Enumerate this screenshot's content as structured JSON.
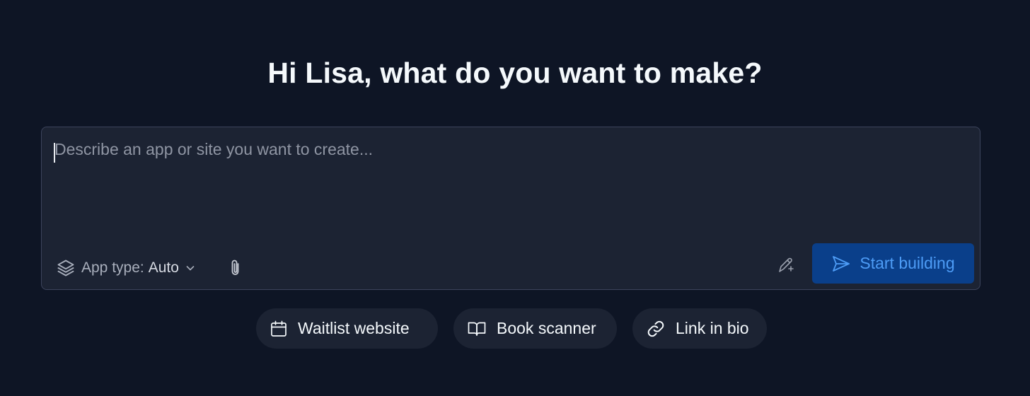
{
  "greeting": "Hi Lisa, what do you want to make?",
  "prompt": {
    "placeholder": "Describe an app or site you want to create...",
    "value": ""
  },
  "toolbar": {
    "app_type_label": "App type:",
    "app_type_value": "Auto",
    "app_type_icon": "layers-icon",
    "attach_icon": "paperclip-icon",
    "magic_icon": "magic-pen-icon",
    "start_label": "Start building",
    "start_icon": "send-icon"
  },
  "suggestions": [
    {
      "label": "Waitlist website",
      "icon": "calendar-icon"
    },
    {
      "label": "Book scanner",
      "icon": "book-icon"
    },
    {
      "label": "Link in bio",
      "icon": "link-icon"
    }
  ],
  "colors": {
    "background": "#0e1525",
    "panel": "#1c2333",
    "border": "#3c445c",
    "primary_button": "#0a3f8a",
    "primary_text": "#4d9cf6"
  }
}
